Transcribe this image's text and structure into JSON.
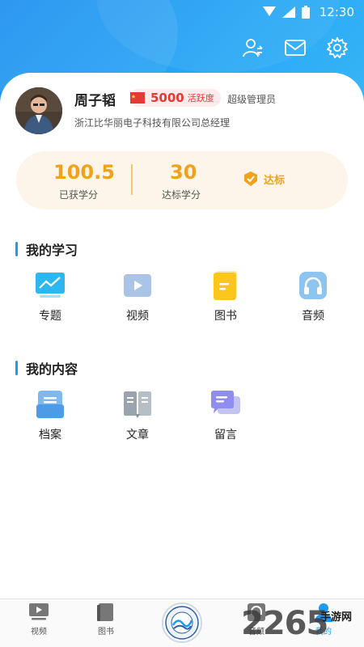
{
  "status_bar": {
    "time": "12:30"
  },
  "profile": {
    "name": "周子韬",
    "activity_score": "5000",
    "activity_label": "活跃度",
    "role": "超级管理员",
    "company": "浙江比华丽电子科技有限公司总经理"
  },
  "credits": {
    "earned_value": "100.5",
    "earned_label": "已获学分",
    "target_value": "30",
    "target_label": "达标学分",
    "status_label": "达标"
  },
  "my_learning": {
    "title": "我的学习",
    "items": [
      {
        "label": "专题",
        "icon": "monitor-chart-icon"
      },
      {
        "label": "视频",
        "icon": "video-play-icon"
      },
      {
        "label": "图书",
        "icon": "book-icon"
      },
      {
        "label": "音频",
        "icon": "headphones-icon"
      }
    ]
  },
  "my_content": {
    "title": "我的内容",
    "items": [
      {
        "label": "档案",
        "icon": "archive-icon"
      },
      {
        "label": "文章",
        "icon": "article-icon"
      },
      {
        "label": "留言",
        "icon": "message-icon"
      }
    ]
  },
  "tabbar": {
    "items": [
      {
        "label": "视频",
        "icon": "video-tab-icon"
      },
      {
        "label": "图书",
        "icon": "book-tab-icon"
      },
      {
        "label": "音频",
        "icon": "audio-tab-icon"
      },
      {
        "label": "我的",
        "icon": "person-tab-icon",
        "active": true
      }
    ]
  },
  "watermark": {
    "number": "2265",
    "site": "手游网"
  },
  "colors": {
    "primary": "#1e9bf0",
    "accent": "#f0a21d",
    "badge_red": "#e53935"
  }
}
